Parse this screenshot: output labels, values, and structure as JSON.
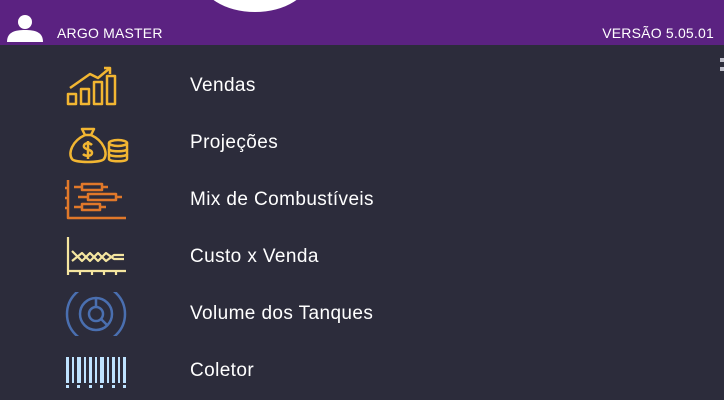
{
  "header": {
    "user_name": "ARGO MASTER",
    "version": "VERSÃO 5.05.01",
    "user_icon": "user-icon",
    "background_color": "#5b2281"
  },
  "menu": {
    "items": [
      {
        "label": "Vendas",
        "icon": "bar-chart-growth-icon",
        "color": "#f2b632"
      },
      {
        "label": "Projeções",
        "icon": "money-bag-icon",
        "color": "#f2b632"
      },
      {
        "label": "Mix de Combustíveis",
        "icon": "horizontal-bars-icon",
        "color": "#e0782a"
      },
      {
        "label": "Custo x Venda",
        "icon": "line-chart-icon",
        "color": "#f5e6a0"
      },
      {
        "label": "Volume dos Tanques",
        "icon": "tank-gauge-icon",
        "color": "#4a6fb0"
      },
      {
        "label": "Coletor",
        "icon": "barcode-icon",
        "color": "#bfe3ff"
      }
    ]
  },
  "colors": {
    "background": "#2c2c3b",
    "text": "#ffffff"
  }
}
